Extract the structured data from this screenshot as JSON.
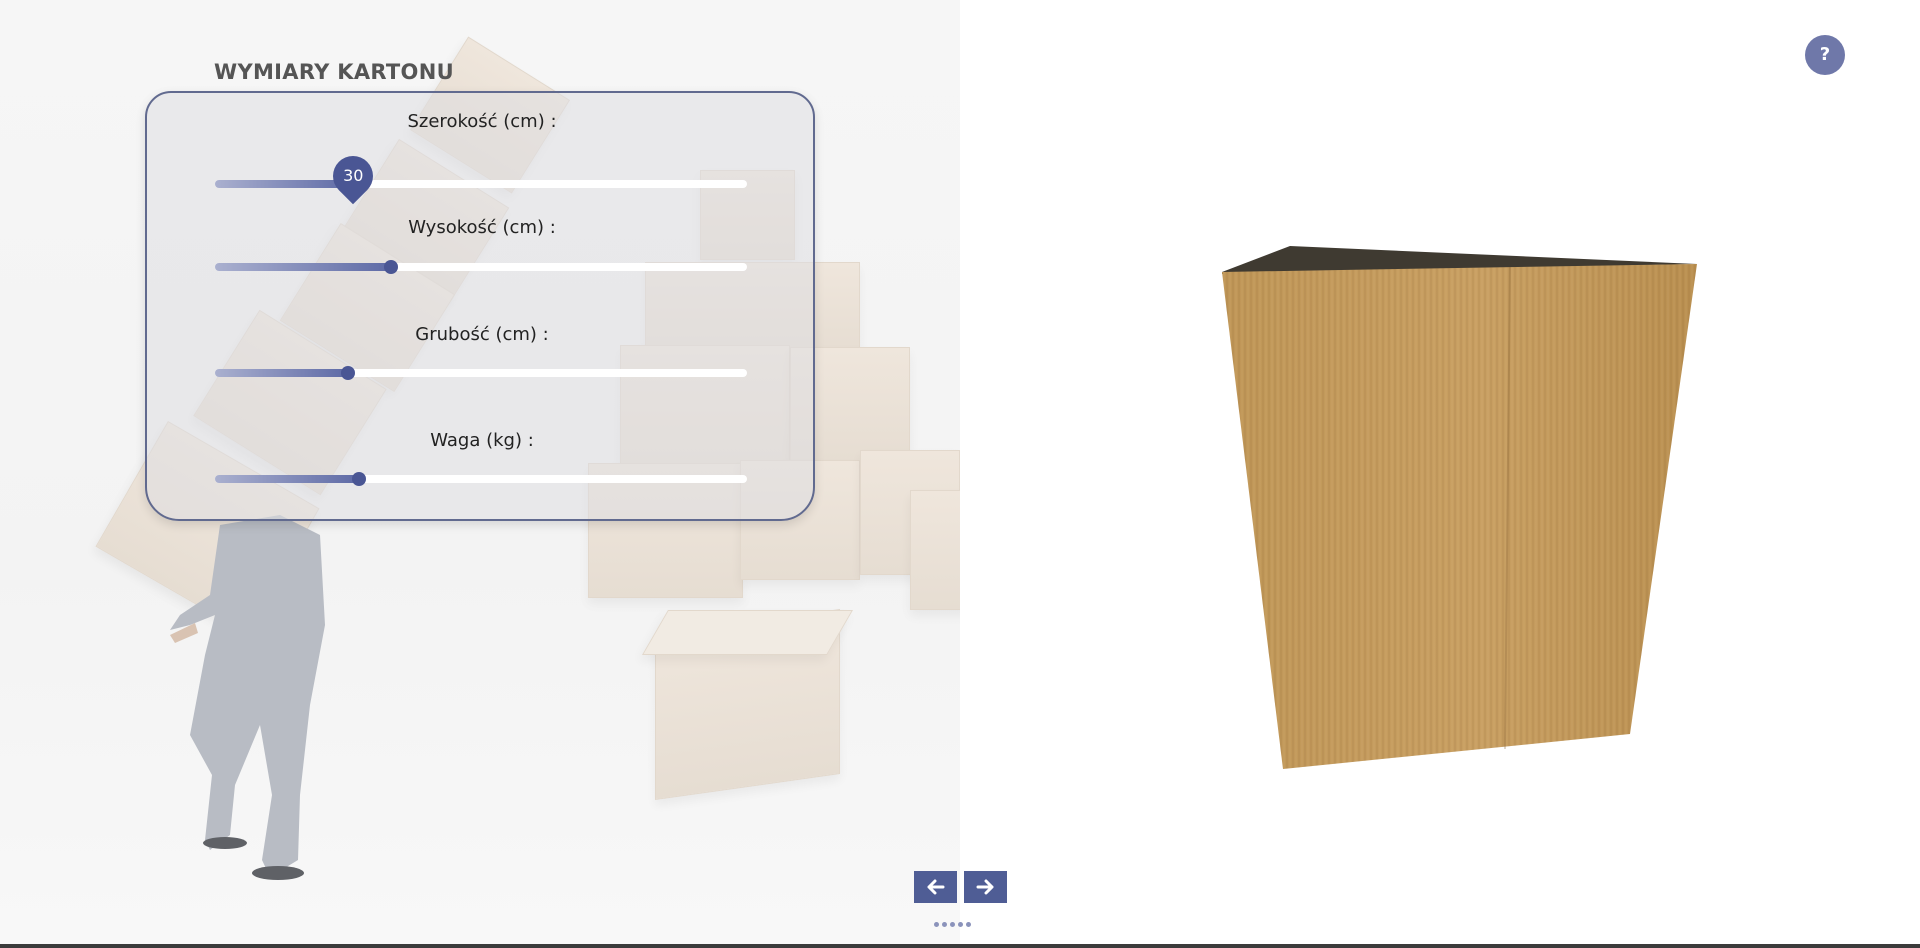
{
  "panel": {
    "title": "WYMIARY KARTONU",
    "sliders": [
      {
        "label": "Szerokość (cm) :",
        "fraction": 0.26,
        "value_bubble": "30"
      },
      {
        "label": "Wysokość (cm) :",
        "fraction": 0.33
      },
      {
        "label": "Grubość (cm) :",
        "fraction": 0.25
      },
      {
        "label": "Waga (kg) :",
        "fraction": 0.27
      }
    ]
  },
  "help": {
    "label": "?"
  },
  "nav": {
    "prev_icon": "arrow-left-icon",
    "next_icon": "arrow-right-icon",
    "dots_count": 5
  },
  "colors": {
    "accent": "#4a5694",
    "panel_border": "#616a8f",
    "cardboard": "#b99152"
  }
}
